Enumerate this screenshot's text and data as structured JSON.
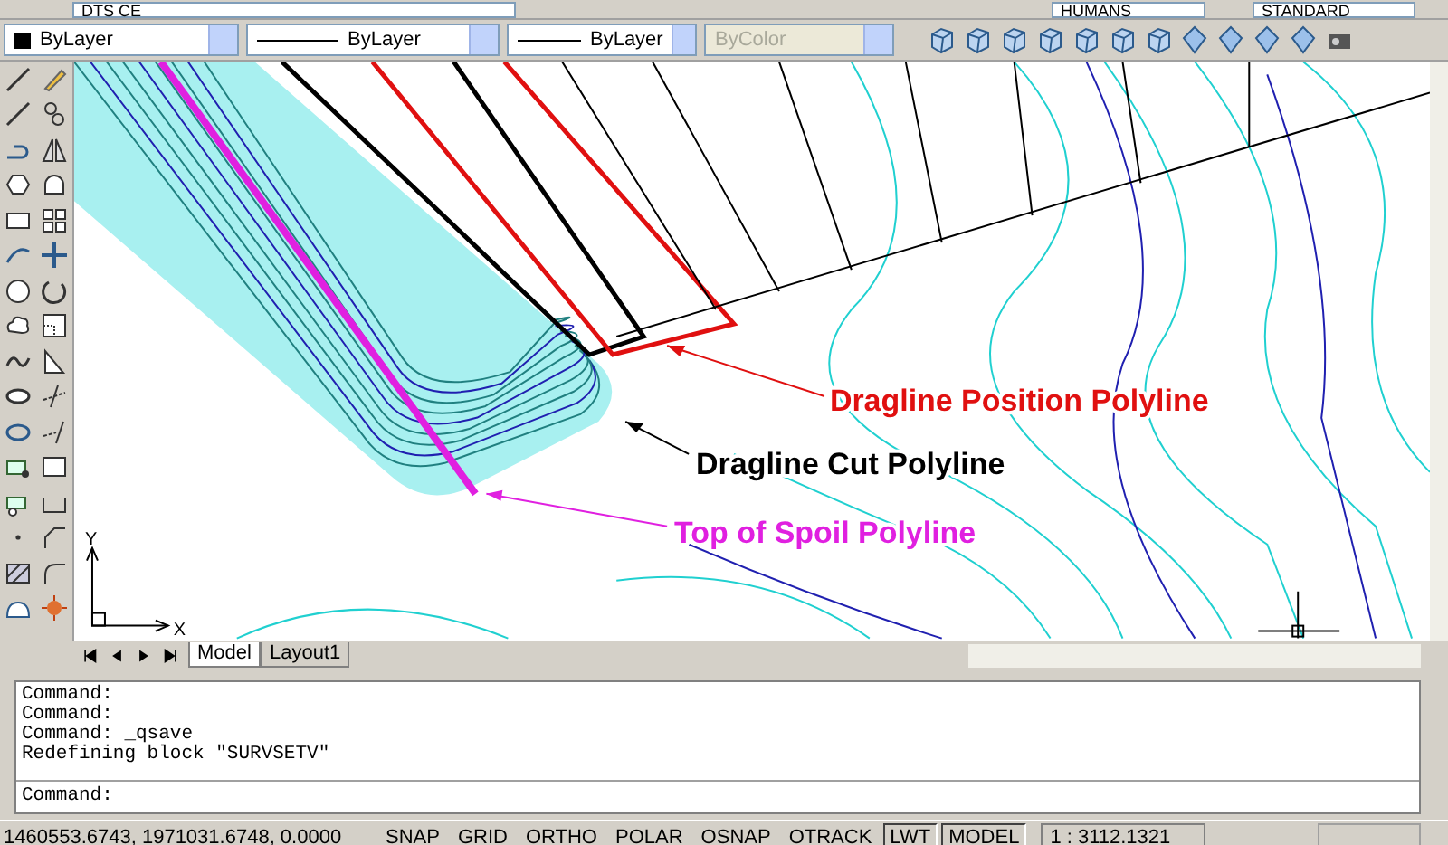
{
  "toolbar_top": {
    "layer": "DTS CE",
    "text_style": "HUMANS",
    "dim_style": "STANDARD"
  },
  "properties": {
    "color_value": "ByLayer",
    "linetype": "ByLayer",
    "lineweight": "ByLayer",
    "plot_style": {
      "value": "ByColor",
      "disabled": true
    }
  },
  "drawing": {
    "labels": [
      {
        "text": "Dragline Position Polyline",
        "color": "#e01010"
      },
      {
        "text": "Dragline Cut Polyline",
        "color": "#000000"
      },
      {
        "text": "Top of Spoil Polyline",
        "color": "#e020e0"
      }
    ],
    "ucs": {
      "y": "Y",
      "x": "X"
    }
  },
  "tabs": [
    {
      "label": "Model",
      "selected": true
    },
    {
      "label": "Layout1",
      "selected": false
    }
  ],
  "command": {
    "history": [
      "Command:",
      "Command:",
      "Command: _qsave",
      "Redefining block \"SURVSETV\""
    ],
    "prompt": "Command:"
  },
  "status_bar": {
    "coordinates": "1460553.6743, 1971031.6748, 0.0000",
    "toggles": [
      {
        "label": "SNAP",
        "on": false
      },
      {
        "label": "GRID",
        "on": false
      },
      {
        "label": "ORTHO",
        "on": false
      },
      {
        "label": "POLAR",
        "on": false
      },
      {
        "label": "OSNAP",
        "on": false
      },
      {
        "label": "OTRACK",
        "on": false
      },
      {
        "label": "LWT",
        "on": true
      },
      {
        "label": "MODEL",
        "on": true
      }
    ],
    "scale": "1 : 3112.1321"
  }
}
